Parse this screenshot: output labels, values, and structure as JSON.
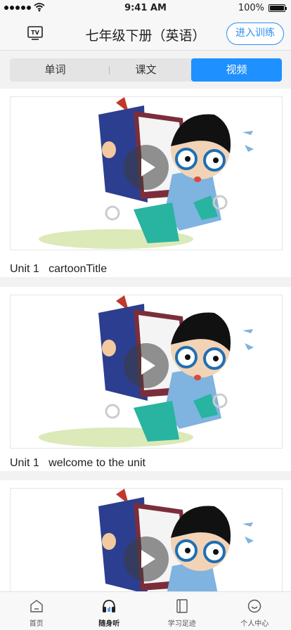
{
  "status_bar": {
    "time": "9:41 AM",
    "battery": "100%"
  },
  "nav": {
    "title": "七年级下册（英语）",
    "enter_button": "进入训练",
    "tv_icon": "tv-icon"
  },
  "tabs": [
    {
      "label": "单词",
      "active": false
    },
    {
      "label": "课文",
      "active": false
    },
    {
      "label": "视频",
      "active": true
    }
  ],
  "videos": [
    {
      "title": "Unit 1   cartoonTitle"
    },
    {
      "title": "Unit 1   welcome to the unit"
    },
    {
      "title": ""
    }
  ],
  "tab_bar": [
    {
      "label": "首页",
      "icon": "home-icon",
      "active": false
    },
    {
      "label": "随身听",
      "icon": "headphones-icon",
      "active": true
    },
    {
      "label": "学习足迹",
      "icon": "book-icon",
      "active": false
    },
    {
      "label": "个人中心",
      "icon": "profile-icon",
      "active": false
    }
  ],
  "colors": {
    "accent": "#1e90ff",
    "outline_button": "#2d8cf0"
  }
}
